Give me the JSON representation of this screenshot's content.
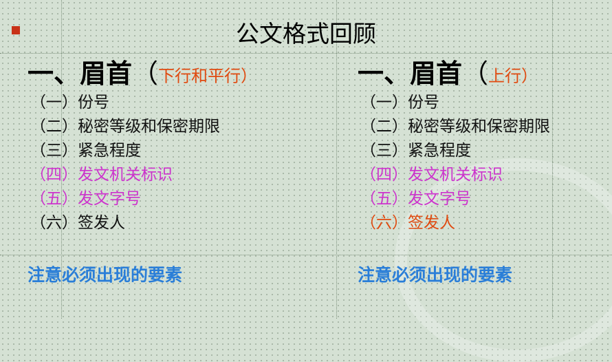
{
  "slide": {
    "title": "公文格式回顾",
    "left": {
      "heading_main": "一、眉首",
      "heading_open": "（",
      "heading_note": "下行和平行",
      "heading_close": "）",
      "items": [
        {
          "text": "（一）份号",
          "color": "#111111"
        },
        {
          "text": "（二）秘密等级和保密期限",
          "color": "#111111"
        },
        {
          "text": "（三）紧急程度",
          "color": "#111111"
        },
        {
          "text": "（四）发文机关标识",
          "color": "#cc33cc"
        },
        {
          "text": "（五）发文字号",
          "color": "#cc33cc"
        },
        {
          "text": "（六）签发人",
          "color": "#111111"
        }
      ],
      "notice": "注意必须出现的要素"
    },
    "right": {
      "heading_main": "一、眉首",
      "heading_open": "（",
      "heading_note": "上行",
      "heading_close": "）",
      "items": [
        {
          "text": "（一）份号",
          "color": "#111111"
        },
        {
          "text": "（二）秘密等级和保密期限",
          "color": "#111111"
        },
        {
          "text": "（三）紧急程度",
          "color": "#111111"
        },
        {
          "text": "（四）发文机关标识",
          "color": "#cc33cc"
        },
        {
          "text": "（五）发文字号",
          "color": "#cc33cc"
        },
        {
          "text": "（六）签发人",
          "color": "#e04a10"
        }
      ],
      "notice": "注意必须出现的要素"
    },
    "colors": {
      "background": "#d5e1d4",
      "bullet": "#c83218",
      "note": "#e04a10",
      "magenta": "#cc33cc",
      "notice": "#2a7ed8"
    }
  }
}
